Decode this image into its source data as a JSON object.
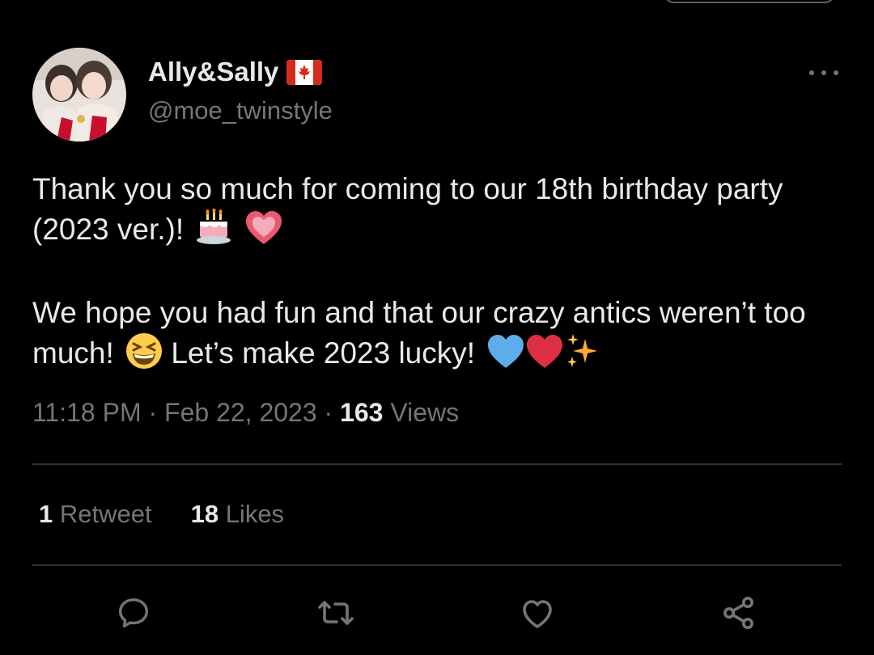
{
  "author": {
    "display_name": "Ally&Sally",
    "handle": "@moe_twinstyle"
  },
  "tweet": {
    "line1": "Thank you so much for coming to our 18th birthday party (2023 ver.)!",
    "line2a": "We hope you had fun and that our crazy antics weren’t too much!",
    "line2b": "Let’s make 2023 lucky!"
  },
  "meta": {
    "time": "11:18 PM",
    "sep1": " · ",
    "date": "Feb 22, 2023",
    "sep2": " · ",
    "views_count": "163",
    "views_label": " Views"
  },
  "stats": {
    "retweets_count": "1",
    "retweets_label": " Retweet",
    "likes_count": "18",
    "likes_label": " Likes"
  },
  "icons": {
    "reply": "reply-icon",
    "retweet": "retweet-icon",
    "like": "heart-icon",
    "share": "share-icon",
    "more": "more-icon"
  },
  "colors": {
    "background": "#000000",
    "text": "#e7e9ea",
    "muted": "#71767b",
    "divider": "#2f3336"
  }
}
